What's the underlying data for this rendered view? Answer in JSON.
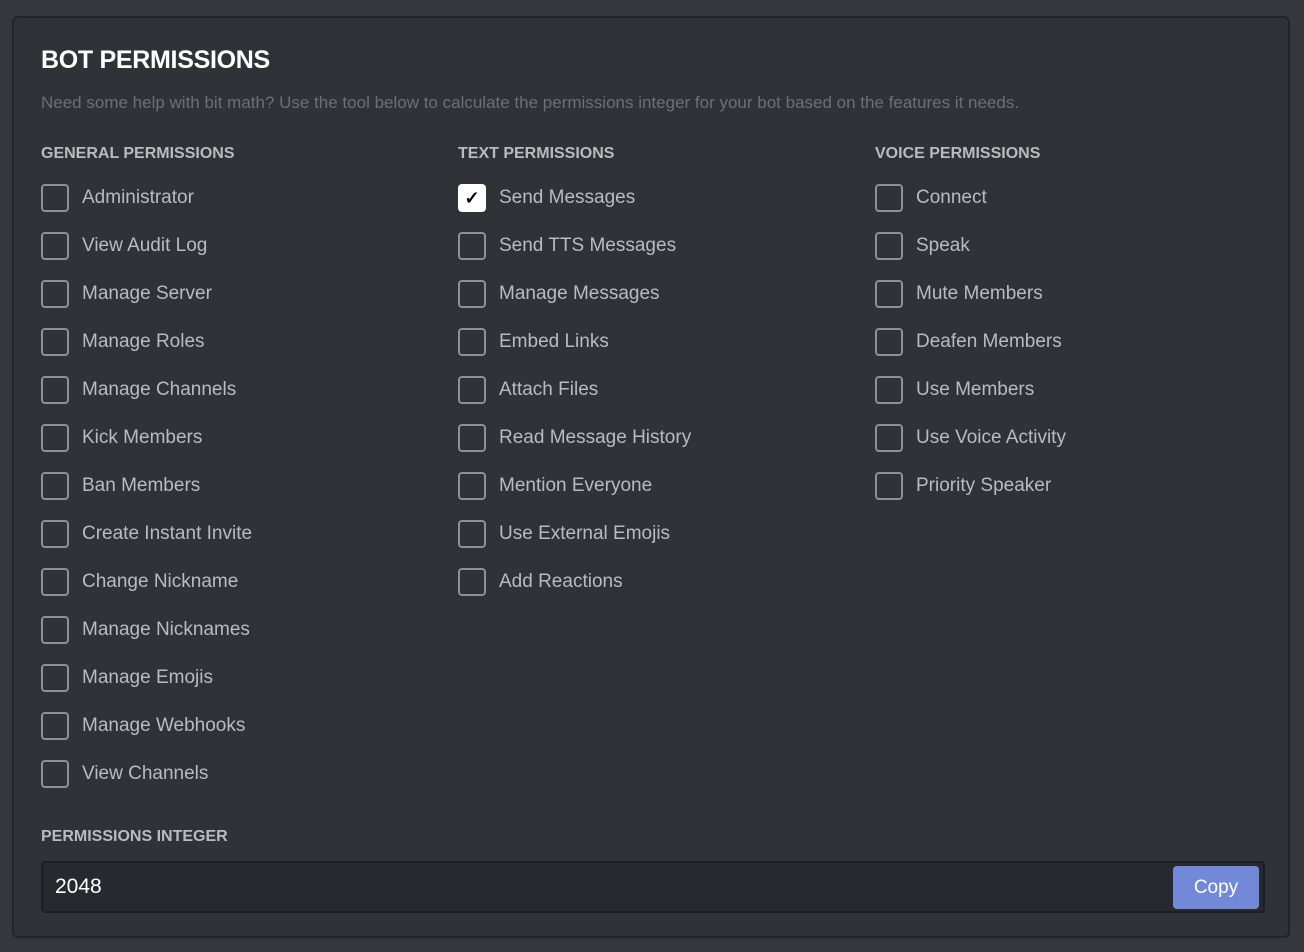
{
  "header": {
    "title": "BOT PERMISSIONS",
    "description": "Need some help with bit math? Use the tool below to calculate the permissions integer for your bot based on the features it needs."
  },
  "columns": [
    {
      "heading": "GENERAL PERMISSIONS",
      "items": [
        {
          "label": "Administrator",
          "checked": false
        },
        {
          "label": "View Audit Log",
          "checked": false
        },
        {
          "label": "Manage Server",
          "checked": false
        },
        {
          "label": "Manage Roles",
          "checked": false
        },
        {
          "label": "Manage Channels",
          "checked": false
        },
        {
          "label": "Kick Members",
          "checked": false
        },
        {
          "label": "Ban Members",
          "checked": false
        },
        {
          "label": "Create Instant Invite",
          "checked": false
        },
        {
          "label": "Change Nickname",
          "checked": false
        },
        {
          "label": "Manage Nicknames",
          "checked": false
        },
        {
          "label": "Manage Emojis",
          "checked": false
        },
        {
          "label": "Manage Webhooks",
          "checked": false
        },
        {
          "label": "View Channels",
          "checked": false
        }
      ]
    },
    {
      "heading": "TEXT PERMISSIONS",
      "items": [
        {
          "label": "Send Messages",
          "checked": true
        },
        {
          "label": "Send TTS Messages",
          "checked": false
        },
        {
          "label": "Manage Messages",
          "checked": false
        },
        {
          "label": "Embed Links",
          "checked": false
        },
        {
          "label": "Attach Files",
          "checked": false
        },
        {
          "label": "Read Message History",
          "checked": false
        },
        {
          "label": "Mention Everyone",
          "checked": false
        },
        {
          "label": "Use External Emojis",
          "checked": false
        },
        {
          "label": "Add Reactions",
          "checked": false
        }
      ]
    },
    {
      "heading": "VOICE PERMISSIONS",
      "items": [
        {
          "label": "Connect",
          "checked": false
        },
        {
          "label": "Speak",
          "checked": false
        },
        {
          "label": "Mute Members",
          "checked": false
        },
        {
          "label": "Deafen Members",
          "checked": false
        },
        {
          "label": "Use Members",
          "checked": false
        },
        {
          "label": "Use Voice Activity",
          "checked": false
        },
        {
          "label": "Priority Speaker",
          "checked": false
        }
      ]
    }
  ],
  "integer": {
    "heading": "PERMISSIONS INTEGER",
    "value": "2048",
    "copy_label": "Copy"
  },
  "icons": {
    "checkmark": "✓"
  },
  "colors": {
    "accent": "#7289da",
    "panel": "#303238",
    "background": "#36373c"
  }
}
